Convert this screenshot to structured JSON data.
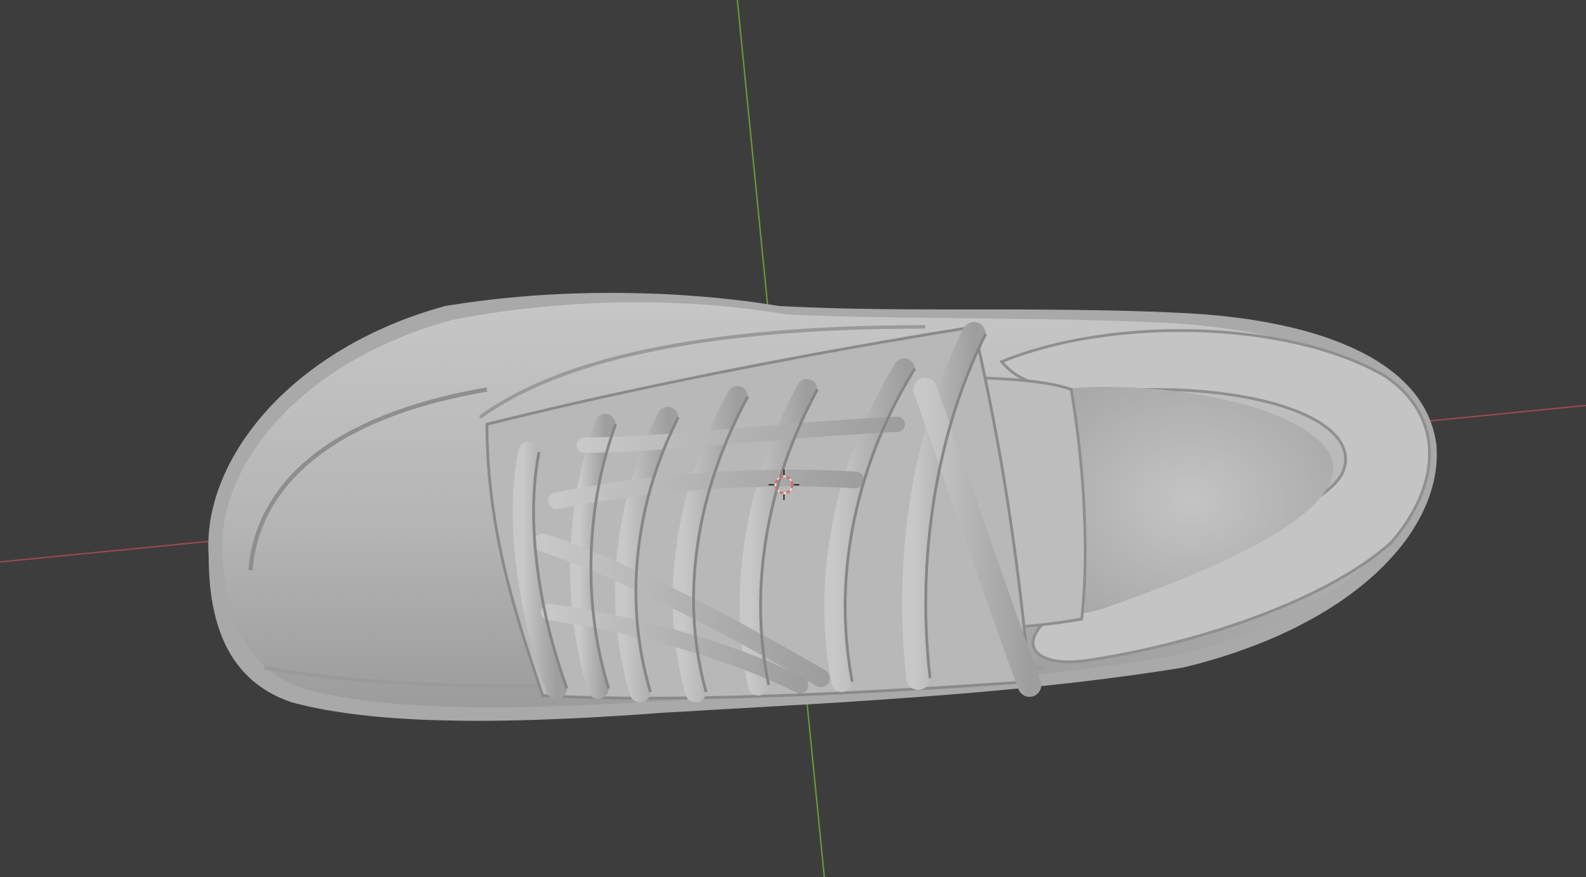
{
  "viewport": {
    "background_color": "#3d3d3d",
    "x_axis_color": "#9a4a52",
    "y_axis_color": "#6e9a36",
    "model_color": "#b9b9b9",
    "model_shadow_color": "#8a8a8a",
    "model_highlight_color": "#d2d2d2",
    "cursor_color": "#d86a6a",
    "model_object": "sneaker-mesh",
    "cursor_icon": "3d-cursor-icon"
  }
}
